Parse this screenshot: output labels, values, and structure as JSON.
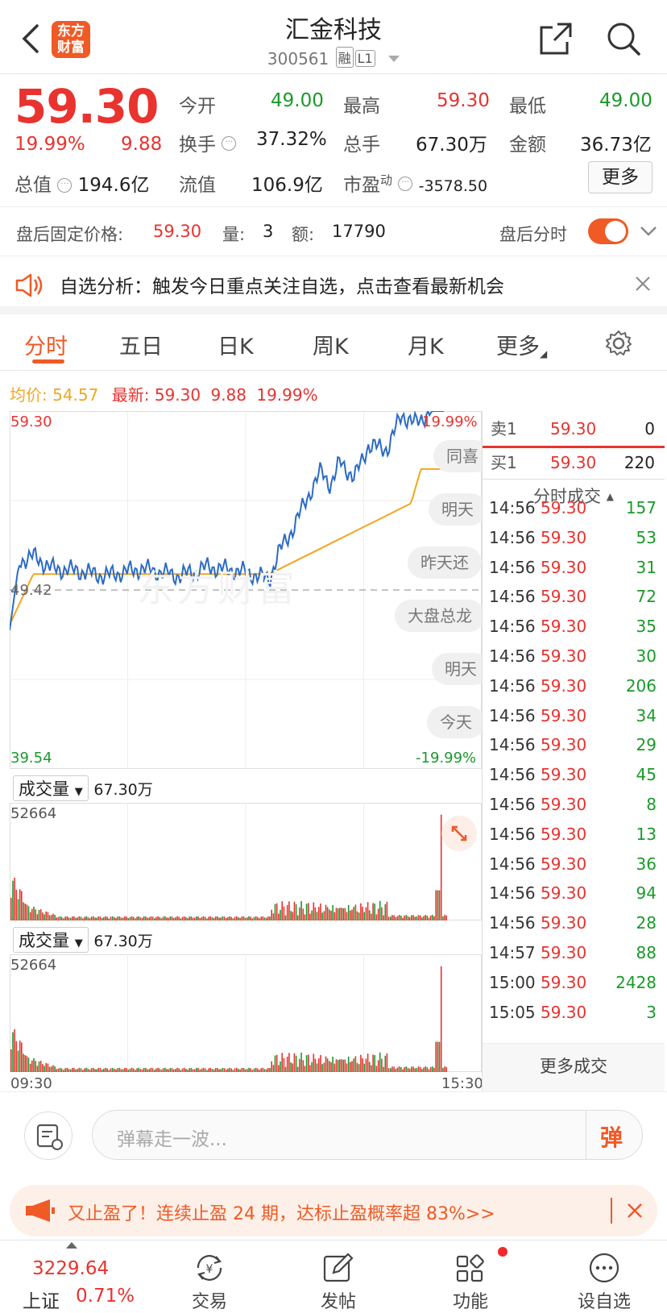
{
  "header": {
    "title": "汇金科技",
    "code": "300561",
    "tag_rong": "融",
    "tag_level": "L1",
    "logo_line1": "东方",
    "logo_line2": "财富"
  },
  "quote": {
    "price": "59.30",
    "change_pct": "19.99%",
    "change": "9.88",
    "open_label": "今开",
    "open": "49.00",
    "high_label": "最高",
    "high": "59.30",
    "low_label": "最低",
    "low": "49.00",
    "turnover_label": "换手",
    "turnover": "37.32%",
    "volume_label": "总手",
    "volume": "67.30万",
    "amount_label": "金额",
    "amount": "36.73亿",
    "mcap_label": "总值",
    "mcap": "194.6亿",
    "float_label": "流值",
    "float": "106.9亿",
    "pe_label": "市盈",
    "pe_sup": "动",
    "pe": "-3578.50",
    "more": "更多"
  },
  "afterhours": {
    "price_label": "盘后固定价格:",
    "price": "59.30",
    "vol_label": "量:",
    "vol": "3",
    "amt_label": "额:",
    "amt": "17790",
    "intraday_label": "盘后分时"
  },
  "banner": {
    "text": "自选分析：触发今日重点关注自选，点击查看最新机会"
  },
  "tabs": [
    "分时",
    "五日",
    "日K",
    "周K",
    "月K",
    "更多"
  ],
  "avg": {
    "avg_label": "均价:",
    "avg": "54.57",
    "latest_label": "最新:",
    "latest": "59.30",
    "chg": "9.88",
    "pct": "19.99%"
  },
  "chart": {
    "top_price": "59.30",
    "mid_price": "49.42",
    "bottom_price": "39.54",
    "top_pct": "19.99%",
    "bottom_pct": "-19.99%",
    "watermark": "东方财富",
    "bubbles": [
      "同喜",
      "明天",
      "昨天还",
      "大盘总龙",
      "明天",
      "今天"
    ],
    "vol_label": "成交量",
    "vol_total": "67.30万",
    "vol_max": "52664",
    "time_start": "09:30",
    "time_end": "15:30"
  },
  "orderbook": {
    "sell_label": "卖1",
    "sell_price": "59.30",
    "sell_vol": "0",
    "buy_label": "买1",
    "buy_price": "59.30",
    "buy_vol": "220",
    "ticks_title": "分时成交",
    "more": "更多成交"
  },
  "ticks": [
    {
      "t": "14:56",
      "p": "59.30",
      "v": "157"
    },
    {
      "t": "14:56",
      "p": "59.30",
      "v": "53"
    },
    {
      "t": "14:56",
      "p": "59.30",
      "v": "31"
    },
    {
      "t": "14:56",
      "p": "59.30",
      "v": "72"
    },
    {
      "t": "14:56",
      "p": "59.30",
      "v": "35"
    },
    {
      "t": "14:56",
      "p": "59.30",
      "v": "30"
    },
    {
      "t": "14:56",
      "p": "59.30",
      "v": "206"
    },
    {
      "t": "14:56",
      "p": "59.30",
      "v": "34"
    },
    {
      "t": "14:56",
      "p": "59.30",
      "v": "29"
    },
    {
      "t": "14:56",
      "p": "59.30",
      "v": "45"
    },
    {
      "t": "14:56",
      "p": "59.30",
      "v": "8"
    },
    {
      "t": "14:56",
      "p": "59.30",
      "v": "13"
    },
    {
      "t": "14:56",
      "p": "59.30",
      "v": "36"
    },
    {
      "t": "14:56",
      "p": "59.30",
      "v": "94"
    },
    {
      "t": "14:56",
      "p": "59.30",
      "v": "28"
    },
    {
      "t": "14:57",
      "p": "59.30",
      "v": "88"
    },
    {
      "t": "15:00",
      "p": "59.30",
      "v": "2428"
    },
    {
      "t": "15:05",
      "p": "59.30",
      "v": "3"
    }
  ],
  "input": {
    "placeholder": "弹幕走一波...",
    "danmu": "弹"
  },
  "promo": {
    "text": "又止盈了！连续止盈 24 期，达标止盈概率超 83%>>"
  },
  "nav": {
    "index_value": "3229.64",
    "index_name": "上证",
    "index_pct": "0.71%",
    "items": [
      "交易",
      "发帖",
      "功能",
      "设自选"
    ]
  },
  "colors": {
    "up": "#e8332f",
    "down": "#1a9a2a",
    "avg": "#f1a622",
    "price_line": "#2c6bc4",
    "accent": "#ef5a26"
  }
}
